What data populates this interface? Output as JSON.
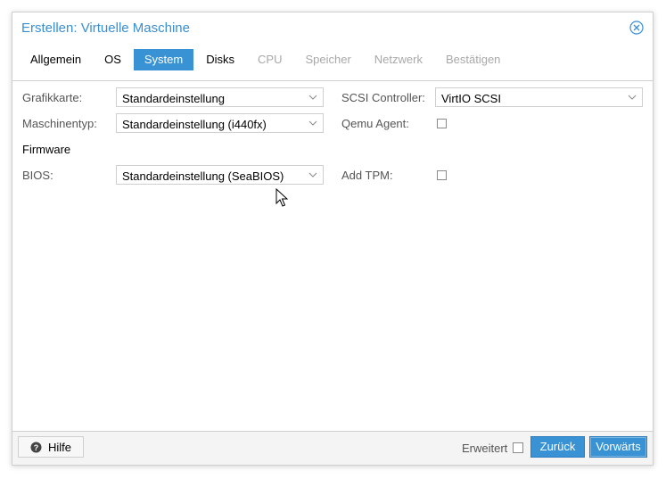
{
  "dialog": {
    "title": "Erstellen: Virtuelle Maschine",
    "tabs": [
      {
        "label": "Allgemein",
        "state": "normal"
      },
      {
        "label": "OS",
        "state": "normal"
      },
      {
        "label": "System",
        "state": "active"
      },
      {
        "label": "Disks",
        "state": "normal"
      },
      {
        "label": "CPU",
        "state": "disabled"
      },
      {
        "label": "Speicher",
        "state": "disabled"
      },
      {
        "label": "Netzwerk",
        "state": "disabled"
      },
      {
        "label": "Bestätigen",
        "state": "disabled"
      }
    ]
  },
  "form": {
    "graphics_label": "Grafikkarte:",
    "graphics_value": "Standardeinstellung",
    "machine_label": "Maschinentyp:",
    "machine_value": "Standardeinstellung (i440fx)",
    "firmware_heading": "Firmware",
    "bios_label": "BIOS:",
    "bios_value": "Standardeinstellung (SeaBIOS)",
    "scsi_label": "SCSI Controller:",
    "scsi_value": "VirtIO SCSI",
    "qemu_label": "Qemu Agent:",
    "qemu_checked": false,
    "tpm_label": "Add TPM:",
    "tpm_checked": false
  },
  "footer": {
    "help_label": "Hilfe",
    "advanced_label": "Erweitert",
    "advanced_checked": false,
    "back_label": "Zurück",
    "next_label": "Vorwärts"
  },
  "colors": {
    "accent": "#3892d4",
    "title": "#3a8fd3",
    "disabled": "#a8a8a8"
  },
  "icons": {
    "close": "close-circle-icon",
    "help": "question-circle-icon",
    "dropdown": "chevron-down-icon",
    "cursor": "mouse-pointer-icon"
  }
}
